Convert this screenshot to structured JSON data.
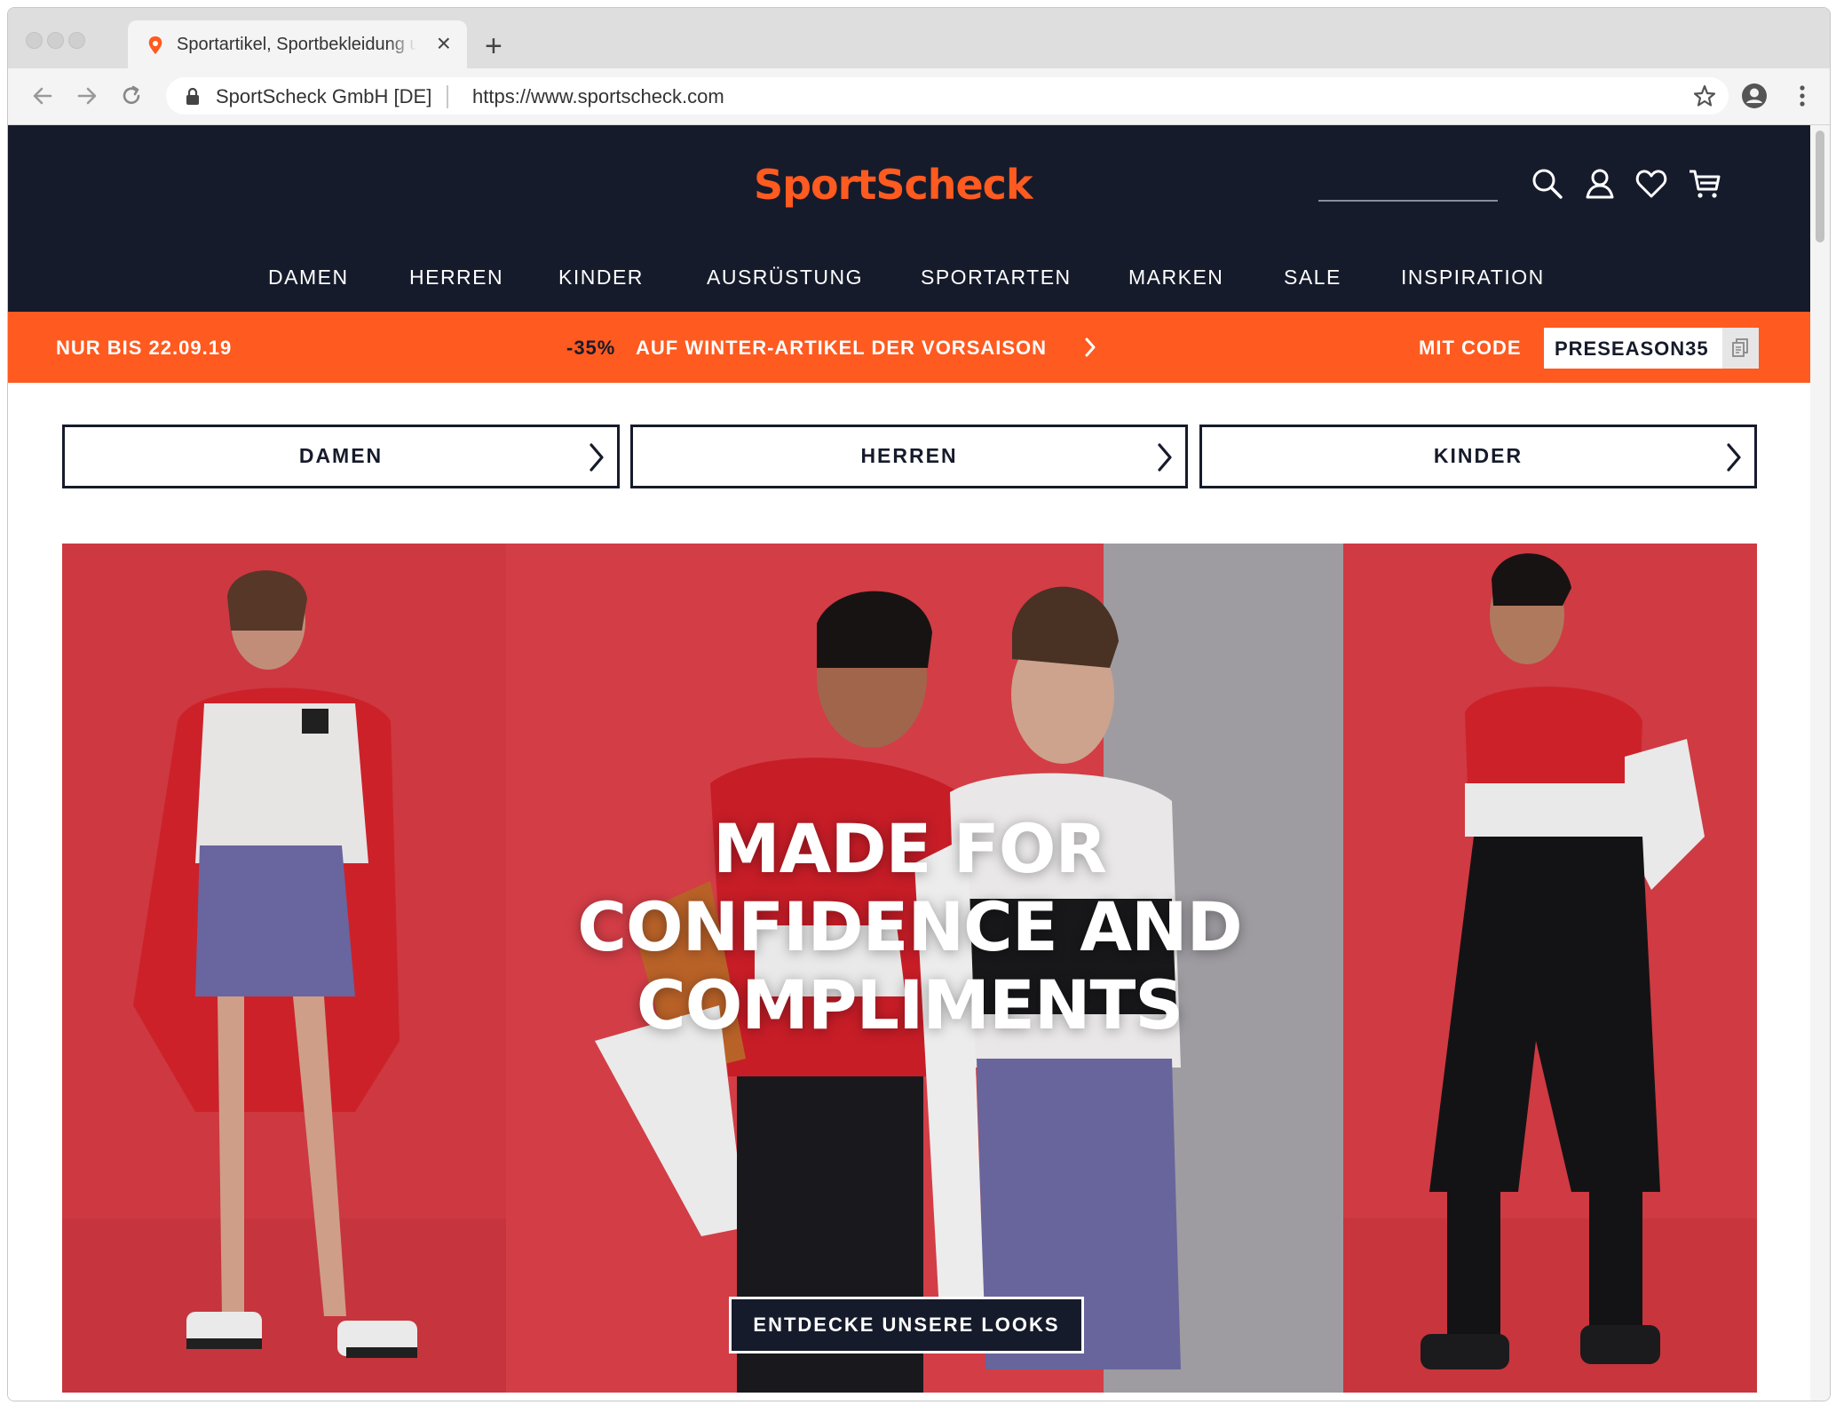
{
  "browser": {
    "tab_title": "Sportartikel, Sportbekleidung u",
    "site_identity": "SportScheck GmbH [DE]",
    "url": "https://www.sportscheck.com"
  },
  "header": {
    "logo_text": "SportScheck",
    "search_placeholder": "",
    "nav": [
      "DAMEN",
      "HERREN",
      "KINDER",
      "AUSRÜSTUNG",
      "SPORTARTEN",
      "MARKEN",
      "SALE",
      "INSPIRATION"
    ]
  },
  "promo": {
    "until": "NUR BIS 22.09.19",
    "discount": "-35%",
    "offer": "AUF WINTER-ARTIKEL DER VORSAISON",
    "code_label": "MIT CODE",
    "code": "PRESEASON35"
  },
  "categories": [
    "DAMEN",
    "HERREN",
    "KINDER"
  ],
  "hero": {
    "headline_1": "MADE FOR",
    "headline_2": "CONFIDENCE AND",
    "headline_3": "COMPLIMENTS",
    "cta": "ENTDECKE UNSERE LOOKS"
  },
  "colors": {
    "brand_orange": "#ff5a1f",
    "header_navy": "#161b2b",
    "hero_red": "#d63b44"
  },
  "icons": {
    "search": "search-icon",
    "account": "user-icon",
    "wishlist": "heart-icon",
    "cart": "cart-icon",
    "copy": "copy-icon"
  }
}
